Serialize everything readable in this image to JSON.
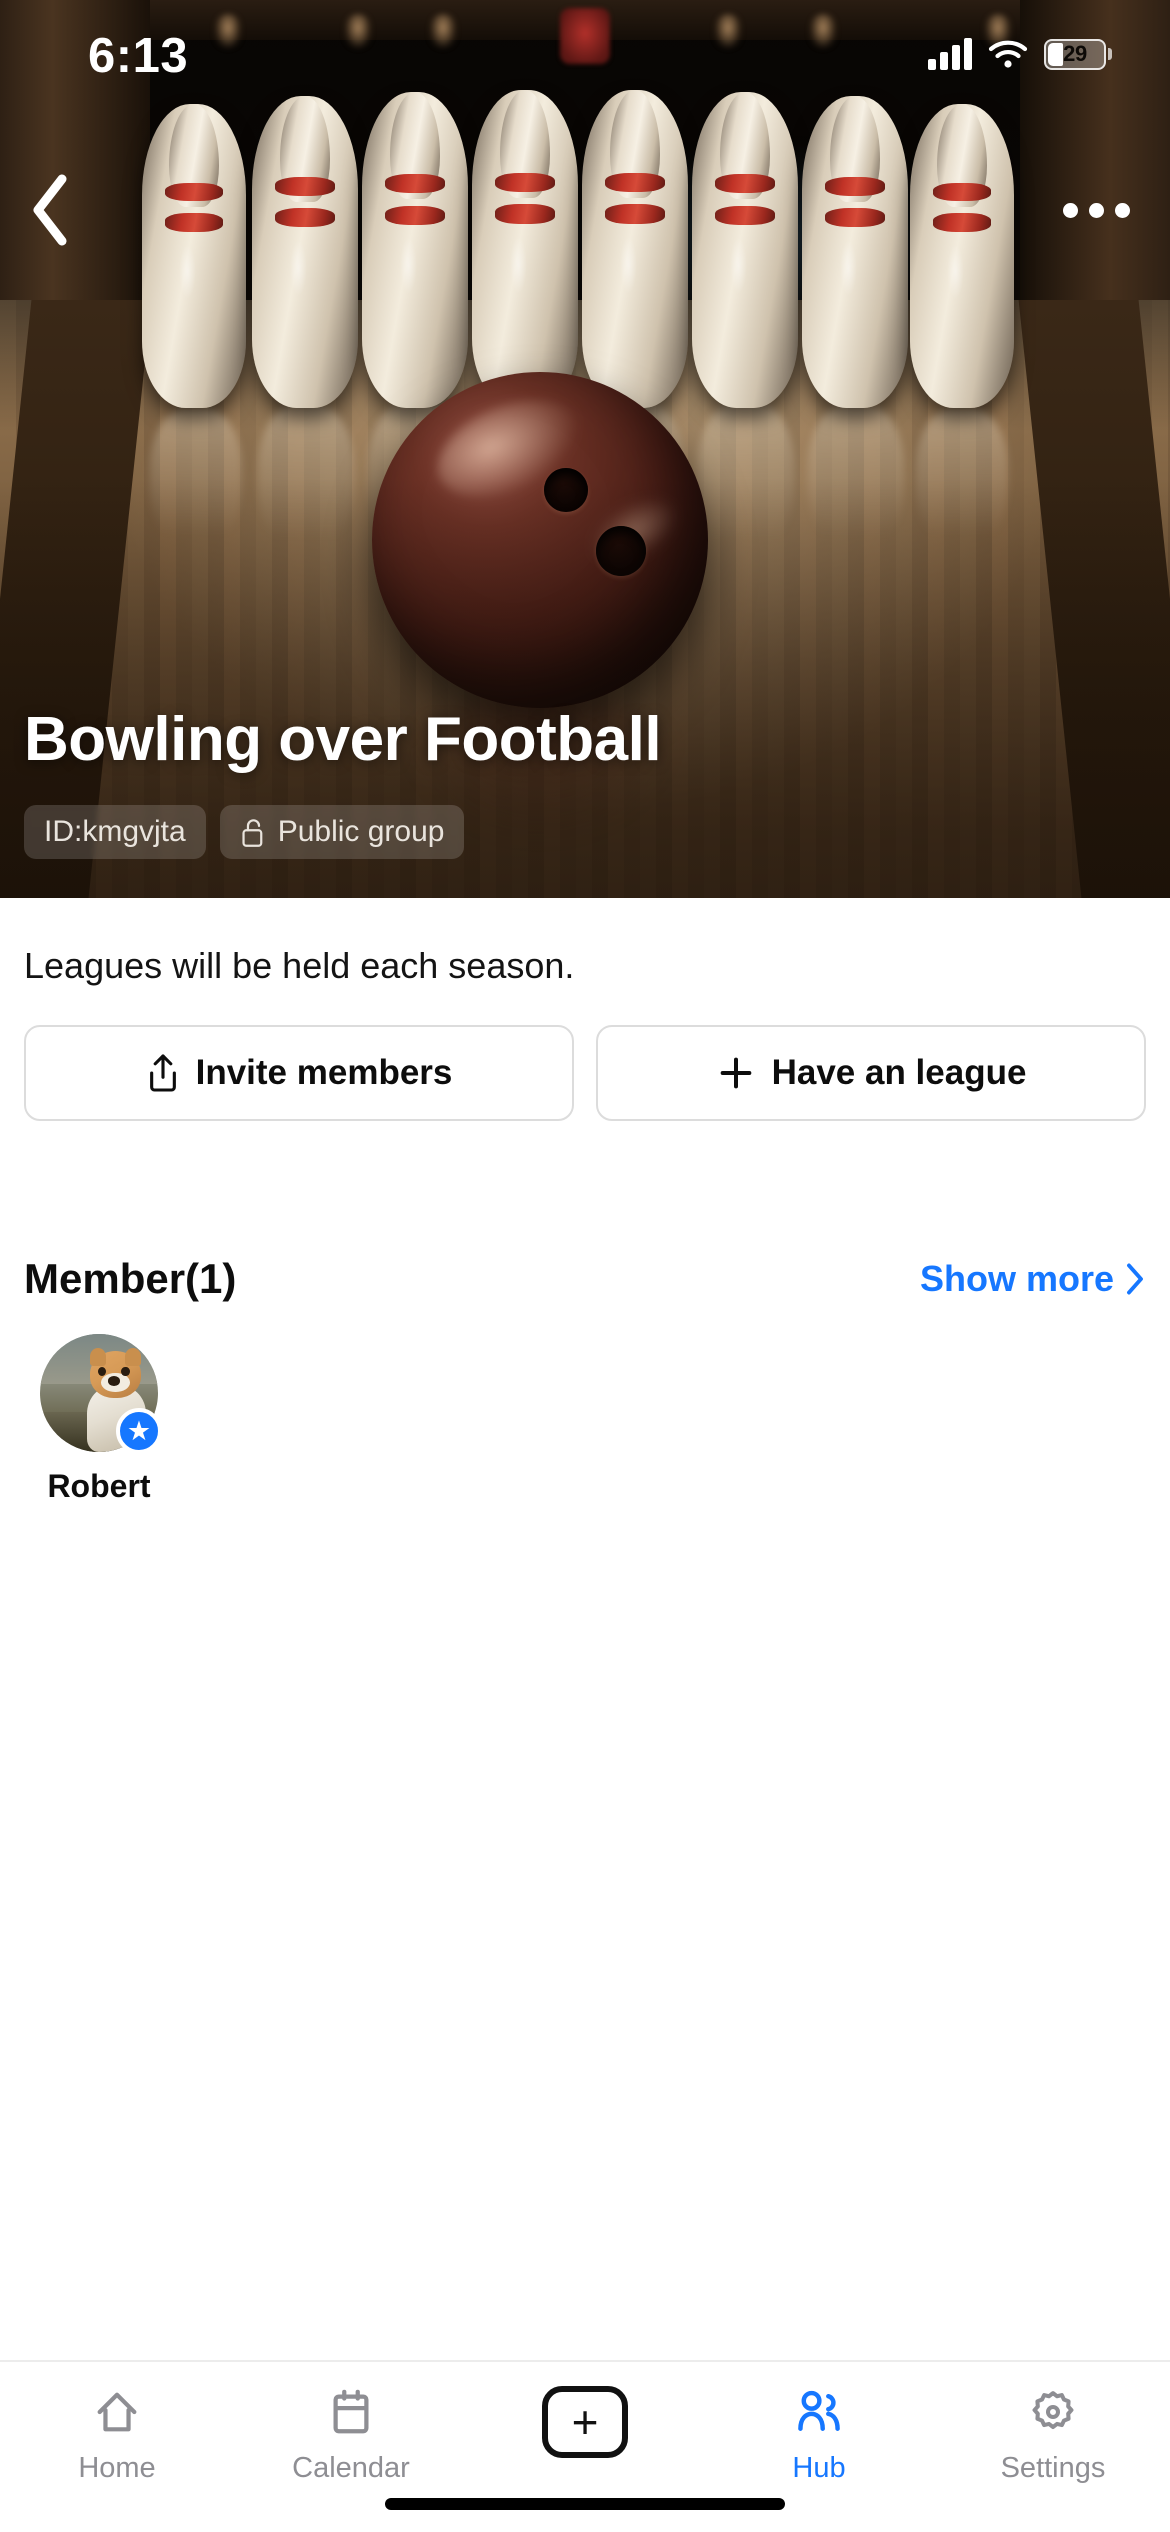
{
  "status_bar": {
    "time": "6:13",
    "signal_icon": "signal-bars-icon",
    "wifi_icon": "wifi-icon",
    "battery_percent": "29"
  },
  "header": {
    "back_icon": "chevron-left-icon",
    "more_icon": "more-options-icon"
  },
  "hero": {
    "title": "Bowling over Football",
    "chips": [
      {
        "label": "ID:kmgvjta",
        "icon": null
      },
      {
        "label": "Public group",
        "icon": "unlock-icon"
      }
    ]
  },
  "main": {
    "description": "Leagues will be held each season.",
    "actions": [
      {
        "label": "Invite members",
        "icon": "share-icon"
      },
      {
        "label": "Have an league",
        "icon": "plus-icon"
      }
    ],
    "members_section": {
      "title": "Member(1)",
      "show_more": "Show more",
      "show_more_icon": "chevron-right-icon",
      "members": [
        {
          "name": "Robert",
          "badge_icon": "star-badge-icon",
          "avatar": "dog-avatar"
        }
      ]
    }
  },
  "tabbar": {
    "tabs": [
      {
        "label": "Home",
        "icon": "home-icon",
        "active": false
      },
      {
        "label": "Calendar",
        "icon": "calendar-icon",
        "active": false
      },
      {
        "label": "",
        "icon": "plus-create-icon",
        "active": false
      },
      {
        "label": "Hub",
        "icon": "people-icon",
        "active": true
      },
      {
        "label": "Settings",
        "icon": "gear-icon",
        "active": false
      }
    ]
  },
  "colors": {
    "accent": "#1677ff",
    "inactive": "#8e8e93",
    "text": "#0d0d0d"
  }
}
